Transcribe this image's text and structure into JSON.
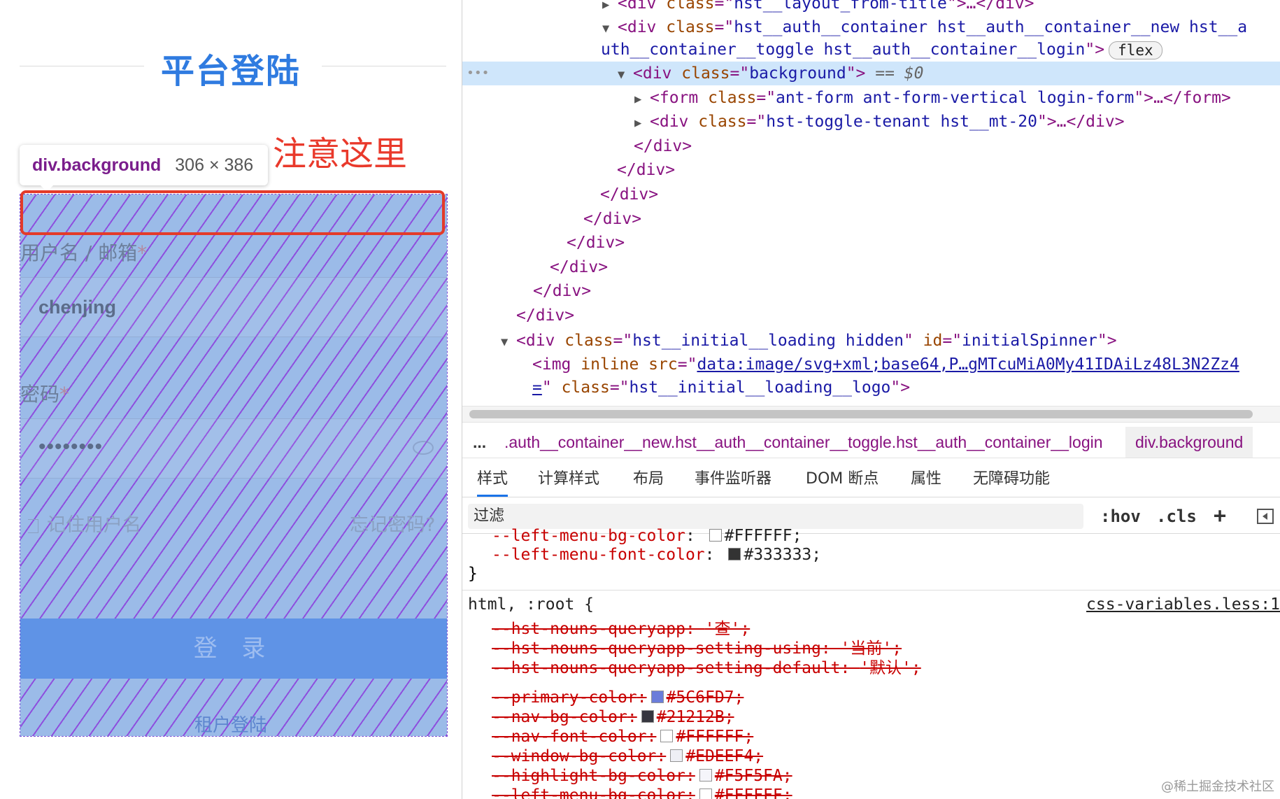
{
  "page": {
    "title": "平台登陆",
    "note": "注意这里",
    "tooltip": {
      "name": "div.background",
      "size": "306 × 386"
    },
    "username_label": "用户名 / 邮箱",
    "username_value": "chenjing",
    "password_label": "密码",
    "required_mark": "*",
    "password_value": "••••••••",
    "remember_label": "记住用户名",
    "forgot_label": "忘记密码?",
    "login_button": "登 录",
    "tenant_link": "租户登陆"
  },
  "dom": {
    "line0": {
      "tag_open": "<div ",
      "attr": "class",
      "eq": "=\"",
      "val": "hst__layout_from-title",
      "tail": "\">…</div>"
    },
    "line1": {
      "tag_open": "<div ",
      "attr": "class",
      "eq": "=\"",
      "val": "hst__auth__container hst__auth__container__new hst__a",
      "tail": ""
    },
    "line1b": {
      "val": "uth__container__toggle hst__auth__container__login",
      "tail": "\">",
      "badge": "flex"
    },
    "line2": {
      "tag_open": "<div ",
      "attr": "class",
      "eq": "=\"",
      "val": "background",
      "tail": "\">",
      "marker": "== $0"
    },
    "line3": {
      "tag_open": "<form ",
      "attr": "class",
      "eq": "=\"",
      "val": "ant-form ant-form-vertical login-form",
      "tail": "\">…</form>"
    },
    "line4": {
      "tag_open": "<div ",
      "attr": "class",
      "eq": "=\"",
      "val": "hst-toggle-tenant hst__mt-20",
      "tail": "\">…</div>"
    },
    "closing": [
      "</div>",
      "</div>",
      "</div>",
      "</div>",
      "</div>",
      "</div>",
      "</div>",
      "</div>"
    ],
    "line13": {
      "tag_open": "<div ",
      "attr": "class",
      "eq": "=\"",
      "val": "hst__initial__loading hidden",
      "mid": "\" ",
      "attr2": "id",
      "eq2": "=\"",
      "val2": "initialSpinner",
      "tail": "\">"
    },
    "line14": {
      "tag_open": "<img ",
      "attr": "inline src",
      "eq": "=\"",
      "link": "data:image/svg+xml;base64,P…gMTcuMiA0My41IDAiLz48L3N2Zz4"
    },
    "line15": {
      "link": "=",
      "mid": "\" ",
      "attr": "class",
      "eq": "=\"",
      "val": "hst__initial__loading__logo",
      "tail": "\">"
    }
  },
  "breadcrumbs": {
    "more": "...",
    "path": ".auth__container__new.hst__auth__container__toggle.hst__auth__container__login",
    "current": "div.background"
  },
  "tabs": [
    "样式",
    "计算样式",
    "布局",
    "事件监听器",
    "DOM 断点",
    "属性",
    "无障碍功能"
  ],
  "active_tab": "样式",
  "filter": {
    "placeholder": "过滤",
    "hov": ":hov",
    "cls": ".cls",
    "add": "+"
  },
  "styles": {
    "top_partial": {
      "prop": "--left-menu-bg-color",
      "colon": ": ",
      "value": "#FFFFFF;"
    },
    "top_line": {
      "prop": "--left-menu-font-color",
      "colon": ": ",
      "value": "#333333;",
      "swatch": "#333333"
    },
    "close_brace": "}",
    "selector": "html, :root {",
    "source": "css-variables.less:1",
    "rules": [
      {
        "prop": "--hst-nouns-queryapp",
        "value": "'查';"
      },
      {
        "prop": "--hst-nouns-queryapp-setting-using",
        "value": "'当前';"
      },
      {
        "prop": "--hst-nouns-queryapp-setting-default",
        "value": "'默认';"
      },
      {
        "prop": "--primary-color",
        "value": "#5C6FD7;",
        "swatch": "#5C6FD7"
      },
      {
        "prop": "--nav-bg-color",
        "value": "#21212B;",
        "swatch": "#21212B"
      },
      {
        "prop": "--nav-font-color",
        "value": "#FFFFFF;",
        "swatch": "#FFFFFF"
      },
      {
        "prop": "--window-bg-color",
        "value": "#EDEEF4;",
        "swatch": "#EDEEF4"
      },
      {
        "prop": "--highlight-bg-color",
        "value": "#F5F5FA;",
        "swatch": "#F5F5FA"
      },
      {
        "prop": "--left-menu-bg-color",
        "value": "#FFFFFF;",
        "swatch": "#FFFFFF"
      }
    ]
  },
  "watermark": "@稀土掘金技术社区",
  "colors": {
    "accent": "#2f7be0",
    "note": "#e9392b",
    "highlight": "#9bbbe8",
    "selected_row": "#cfe6fb"
  }
}
